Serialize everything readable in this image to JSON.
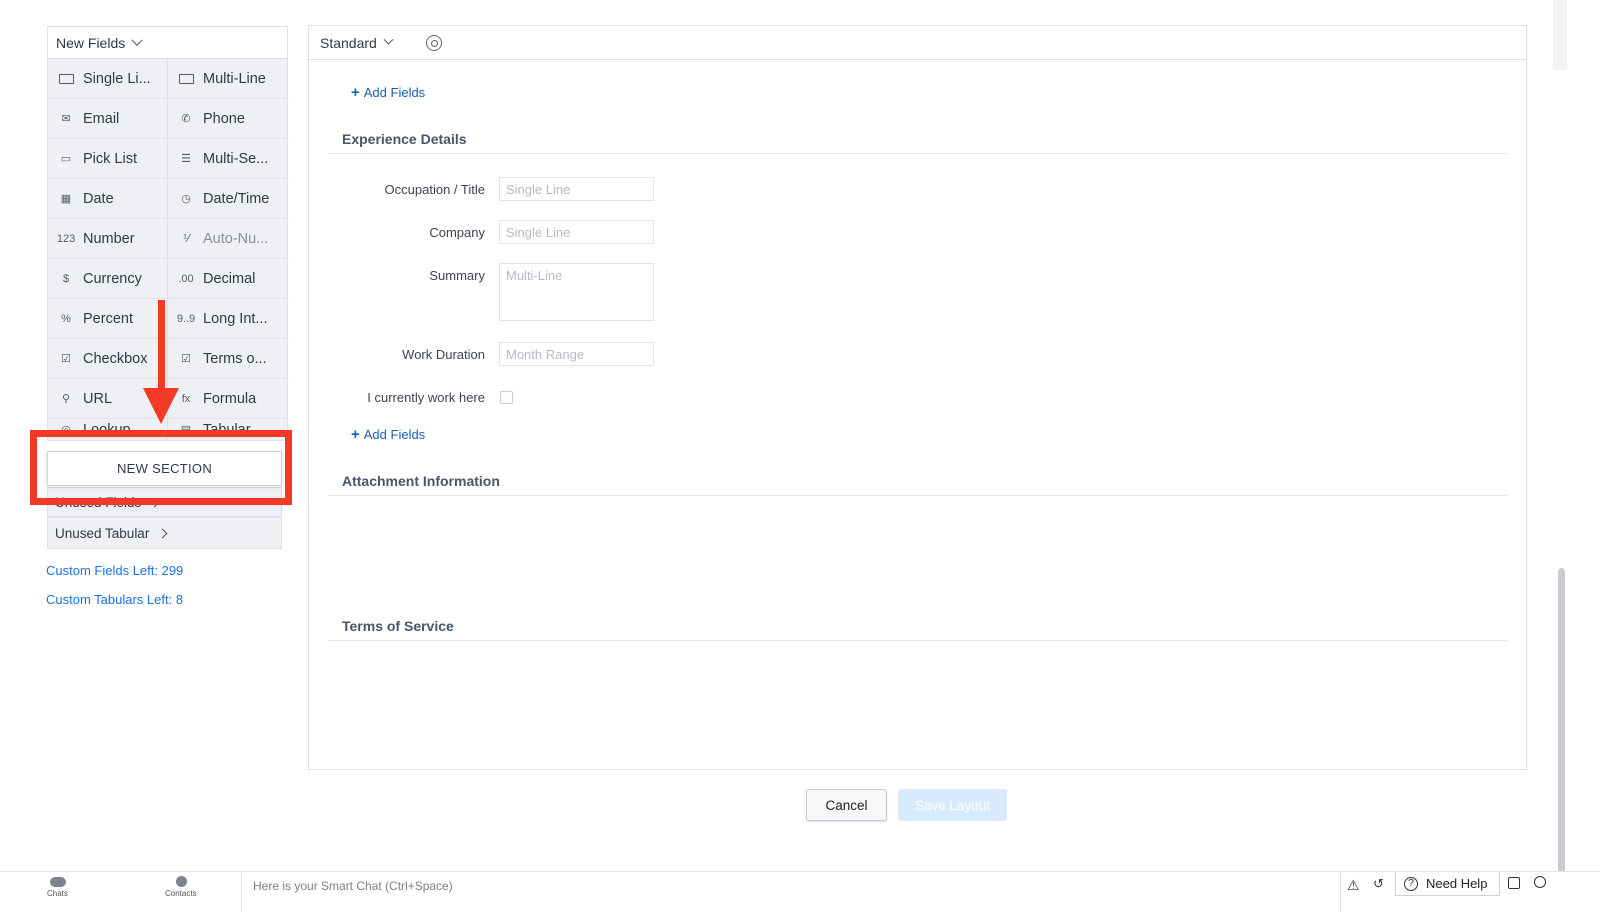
{
  "palette": {
    "header": "New Fields",
    "fields": [
      {
        "label": "Single Li...",
        "icon": "single-line-icon",
        "glyph": ""
      },
      {
        "label": "Multi-Line",
        "icon": "multi-line-icon",
        "glyph": ""
      },
      {
        "label": "Email",
        "icon": "email-icon",
        "glyph": "✉"
      },
      {
        "label": "Phone",
        "icon": "phone-icon",
        "glyph": "✆"
      },
      {
        "label": "Pick List",
        "icon": "pick-list-icon",
        "glyph": "▭"
      },
      {
        "label": "Multi-Se...",
        "icon": "multi-select-icon",
        "glyph": "☰"
      },
      {
        "label": "Date",
        "icon": "date-icon",
        "glyph": "▦"
      },
      {
        "label": "Date/Time",
        "icon": "date-time-icon",
        "glyph": "◷"
      },
      {
        "label": "Number",
        "icon": "number-icon",
        "glyph": "123"
      },
      {
        "label": "Auto-Nu...",
        "icon": "auto-number-icon",
        "glyph": "⅟"
      },
      {
        "label": "Currency",
        "icon": "currency-icon",
        "glyph": "$"
      },
      {
        "label": "Decimal",
        "icon": "decimal-icon",
        "glyph": ".00"
      },
      {
        "label": "Percent",
        "icon": "percent-icon",
        "glyph": "%"
      },
      {
        "label": "Long Int...",
        "icon": "long-integer-icon",
        "glyph": "9..9"
      },
      {
        "label": "Checkbox",
        "icon": "checkbox-icon",
        "glyph": "☑"
      },
      {
        "label": "Terms o...",
        "icon": "terms-icon",
        "glyph": "☑"
      },
      {
        "label": "URL",
        "icon": "url-icon",
        "glyph": "⚲"
      },
      {
        "label": "Formula",
        "icon": "formula-icon",
        "glyph": "fx"
      },
      {
        "label": "Lookup",
        "icon": "lookup-icon",
        "glyph": "◎"
      },
      {
        "label": "Tabular",
        "icon": "tabular-icon",
        "glyph": "▤"
      }
    ],
    "new_section": "NEW SECTION",
    "unused_fields": "Unused Fields",
    "unused_tabular": "Unused Tabular",
    "custom_fields_left": "Custom Fields Left: 299",
    "custom_tabulars_left": "Custom Tabulars Left: 8"
  },
  "panel": {
    "layout_name": "Standard",
    "add_fields": "Add Fields",
    "sections": [
      {
        "title": "Experience Details",
        "fields": [
          {
            "label": "Occupation / Title",
            "type": "Single Line"
          },
          {
            "label": "Company",
            "type": "Single Line"
          },
          {
            "label": "Summary",
            "type": "Multi-Line"
          },
          {
            "label": "Work Duration",
            "type": "Month Range"
          },
          {
            "label": "I currently work here",
            "type": "checkbox"
          }
        ]
      },
      {
        "title": "Attachment Information"
      },
      {
        "title": "Terms of Service"
      }
    ]
  },
  "footer": {
    "cancel": "Cancel",
    "save": "Save Layout"
  },
  "bottombar": {
    "chats": "Chats",
    "contacts": "Contacts",
    "smart_chat_placeholder": "Here is your Smart Chat (Ctrl+Space)",
    "need_help": "Need Help"
  },
  "colors": {
    "annotation_red": "#f23a27",
    "link_blue": "#1a73e8"
  }
}
